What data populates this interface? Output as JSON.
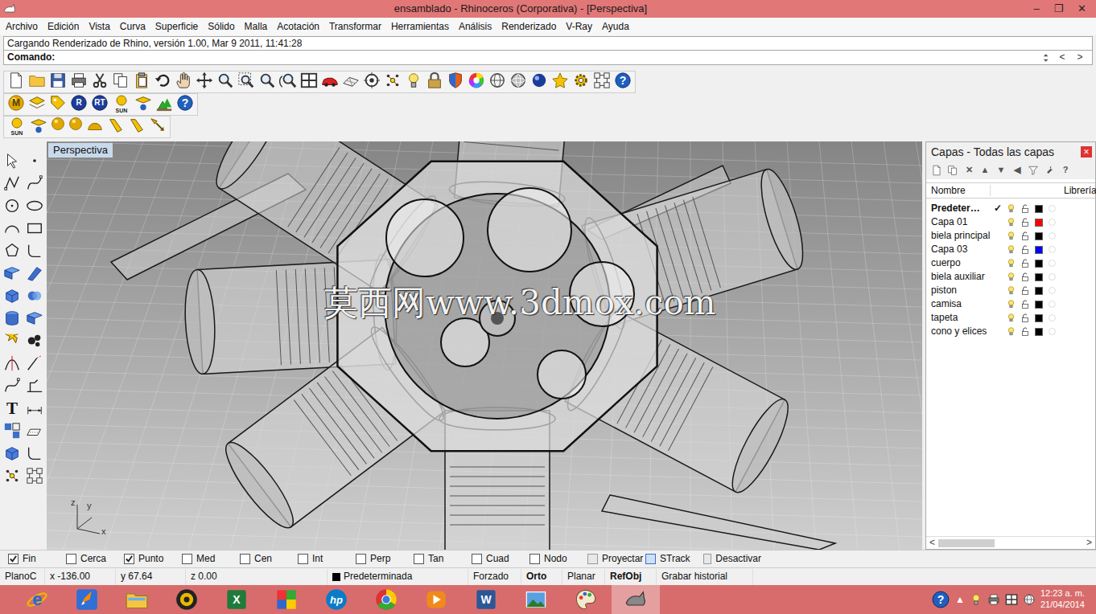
{
  "window": {
    "title": "ensamblado - Rhinoceros (Corporativa) - [Perspectiva]",
    "controls": [
      "–",
      "❐",
      "✕"
    ]
  },
  "menu": [
    "Archivo",
    "Edición",
    "Vista",
    "Curva",
    "Superficie",
    "Sólido",
    "Malla",
    "Acotación",
    "Transformar",
    "Herramientas",
    "Análisis",
    "Renderizado",
    "V-Ray",
    "Ayuda"
  ],
  "command": {
    "history": "Cargando Renderizado de Rhino, versión 1.00, Mar  9 2011, 11:41:28",
    "prompt": "Comando:",
    "nav": [
      "<",
      ">"
    ]
  },
  "toolbars": {
    "standard_help": "?",
    "render": {
      "material": "M",
      "rhino_render": "R",
      "rt_render": "RT",
      "sun": "SUN",
      "help": "?"
    },
    "lights": {
      "sun": "SUN"
    },
    "text_tool": "T"
  },
  "viewport": {
    "label": "Perspectiva",
    "axes": {
      "x": "x",
      "y": "y",
      "z": "z"
    },
    "watermark": "莫西网www.3dmox.com"
  },
  "layers": {
    "title": "Capas - Todas las capas",
    "close": "×",
    "toolbar": [
      {
        "kind": "new"
      },
      {
        "kind": "sublayer"
      },
      {
        "kind": "glyph",
        "label": "✕"
      },
      {
        "kind": "glyph",
        "label": "▲"
      },
      {
        "kind": "glyph",
        "label": "▼"
      },
      {
        "kind": "glyph",
        "label": "◀"
      },
      {
        "kind": "filter"
      },
      {
        "kind": "wrench"
      },
      {
        "kind": "glyph",
        "label": "?"
      }
    ],
    "columns": [
      "Nombre",
      "Librería"
    ],
    "current_mark": "✓",
    "rows": [
      {
        "name": "Predeter…",
        "current": true,
        "visible": true,
        "locked": false,
        "color": "#000000"
      },
      {
        "name": "Capa 01",
        "current": false,
        "visible": true,
        "locked": false,
        "color": "#ff0000"
      },
      {
        "name": "biela principal",
        "current": false,
        "visible": true,
        "locked": false,
        "color": "#000000"
      },
      {
        "name": "Capa 03",
        "current": false,
        "visible": true,
        "locked": false,
        "color": "#0000ff"
      },
      {
        "name": "cuerpo",
        "current": false,
        "visible": true,
        "locked": false,
        "color": "#000000"
      },
      {
        "name": "biela auxiliar",
        "current": false,
        "visible": true,
        "locked": false,
        "color": "#000000"
      },
      {
        "name": "piston",
        "current": false,
        "visible": true,
        "locked": false,
        "color": "#000000"
      },
      {
        "name": "camisa",
        "current": false,
        "visible": true,
        "locked": false,
        "color": "#000000"
      },
      {
        "name": "tapeta",
        "current": false,
        "visible": true,
        "locked": false,
        "color": "#000000"
      },
      {
        "name": "cono y elices",
        "current": false,
        "visible": true,
        "locked": false,
        "color": "#000000"
      }
    ],
    "scroll": [
      "<",
      ">"
    ]
  },
  "osnaps": [
    {
      "label": "Fin",
      "kind": "check",
      "checked": true
    },
    {
      "label": "Cerca",
      "kind": "check",
      "checked": false
    },
    {
      "label": "Punto",
      "kind": "check",
      "checked": true
    },
    {
      "label": "Med",
      "kind": "check",
      "checked": false
    },
    {
      "label": "Cen",
      "kind": "check",
      "checked": false
    },
    {
      "label": "Int",
      "kind": "check",
      "checked": false
    },
    {
      "label": "Perp",
      "kind": "check",
      "checked": false
    },
    {
      "label": "Tan",
      "kind": "check",
      "checked": false
    },
    {
      "label": "Cuad",
      "kind": "check",
      "checked": false
    },
    {
      "label": "Nodo",
      "kind": "check",
      "checked": false
    },
    {
      "label": "Proyectar",
      "kind": "toggle",
      "checked": false
    },
    {
      "label": "STrack",
      "kind": "toggle",
      "checked": true
    },
    {
      "label": "Desactivar",
      "kind": "toggle",
      "checked": false
    }
  ],
  "status_bar": {
    "plane": "PlanoC",
    "x": "x -136.00",
    "y": "y 67.64",
    "z": "z 0.00",
    "layer": {
      "name": "Predeterminada",
      "color": "#000000"
    },
    "toggles": [
      {
        "label": "Forzado",
        "on": false
      },
      {
        "label": "Orto",
        "on": true
      },
      {
        "label": "Planar",
        "on": false
      },
      {
        "label": "RefObj",
        "on": true
      },
      {
        "label": "Grabar historial",
        "on": false
      }
    ]
  },
  "taskbar": {
    "apps": [
      {
        "kind": "ie",
        "label": "e",
        "selected": false
      },
      {
        "kind": "rocket",
        "selected": false
      },
      {
        "kind": "explorer",
        "selected": false
      },
      {
        "kind": "disc",
        "selected": false
      },
      {
        "kind": "excel",
        "label": "X",
        "selected": false
      },
      {
        "kind": "pinwheel",
        "selected": false
      },
      {
        "kind": "hp",
        "label": "hp",
        "selected": false
      },
      {
        "kind": "chrome",
        "selected": false
      },
      {
        "kind": "media",
        "selected": false
      },
      {
        "kind": "word",
        "label": "W",
        "selected": false
      },
      {
        "kind": "photos",
        "selected": false
      },
      {
        "kind": "paint",
        "selected": false
      },
      {
        "kind": "rhino",
        "selected": true
      }
    ],
    "tray": {
      "help": "?",
      "expand": "▲",
      "time": "12:23 a. m.",
      "date": "21/04/2014"
    }
  }
}
